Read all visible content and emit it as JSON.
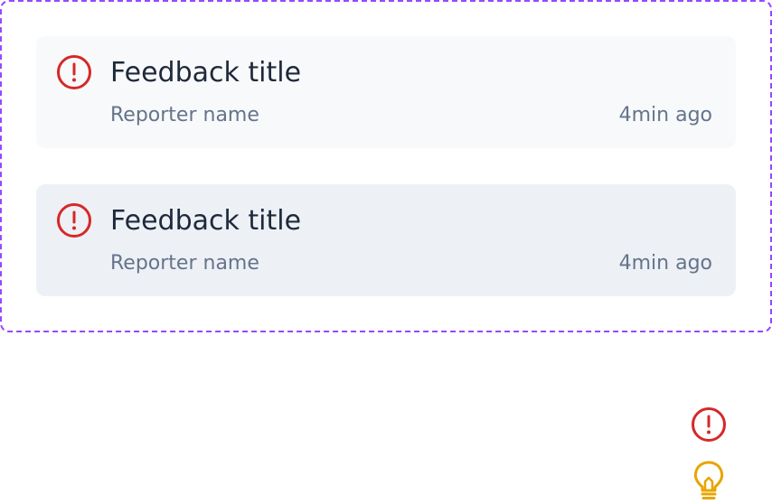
{
  "feedback_items": [
    {
      "title": "Feedback title",
      "reporter": "Reporter name",
      "time": "4min ago",
      "icon": "alert-circle-icon"
    },
    {
      "title": "Feedback title",
      "reporter": "Reporter name",
      "time": "4min ago",
      "icon": "alert-circle-icon"
    }
  ],
  "legend_icons": [
    "alert-circle-icon",
    "lightbulb-icon"
  ],
  "colors": {
    "frame_border": "#9747FF",
    "alert": "#D62828",
    "bulb": "#E8A400",
    "title": "#1E293B",
    "meta": "#64748B",
    "card_default": "#F8F9FA",
    "card_hover": "#EDF0F5"
  }
}
